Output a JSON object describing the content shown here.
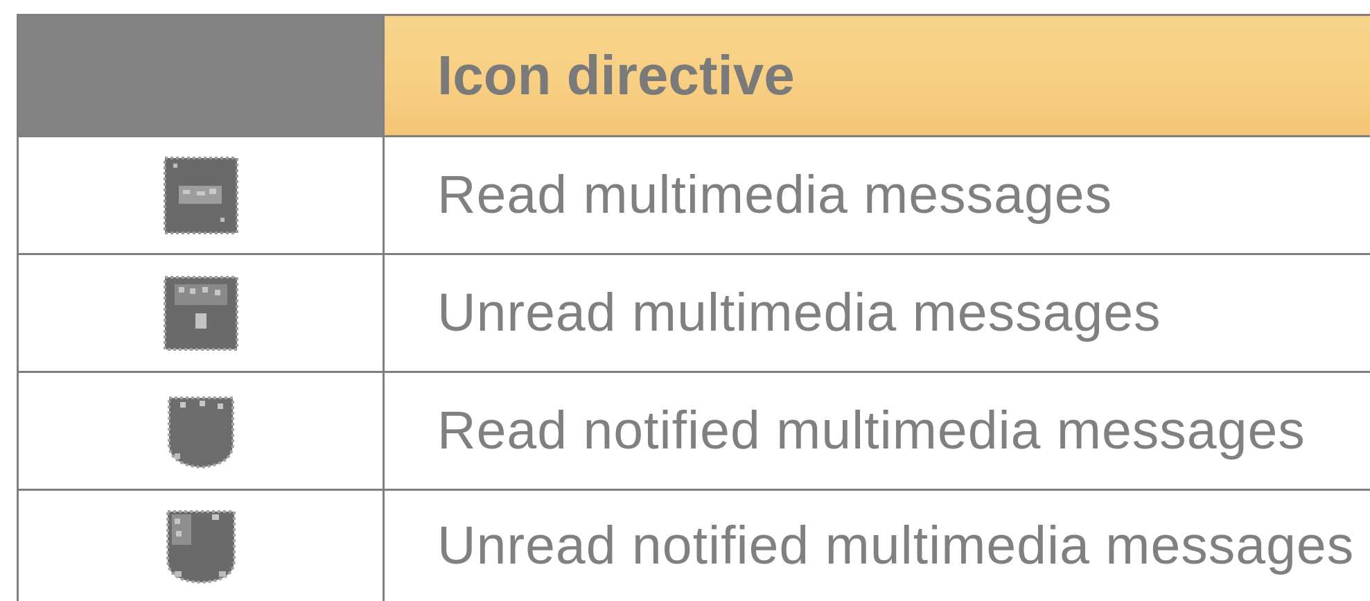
{
  "table": {
    "header": {
      "icon_column": "",
      "description_column": "Icon directive"
    },
    "rows": [
      {
        "icon": "read-mms-icon",
        "description": "Read multimedia messages"
      },
      {
        "icon": "unread-mms-icon",
        "description": "Unread multimedia messages"
      },
      {
        "icon": "read-notified-mms-icon",
        "description": "Read notified multimedia messages"
      },
      {
        "icon": "unread-notified-mms-icon",
        "description": "Unread notified multimedia messages"
      }
    ]
  },
  "colors": {
    "header_gray": "#838383",
    "header_amber": "#f8cf83",
    "border": "#7f7f7f",
    "text": "#808080"
  }
}
